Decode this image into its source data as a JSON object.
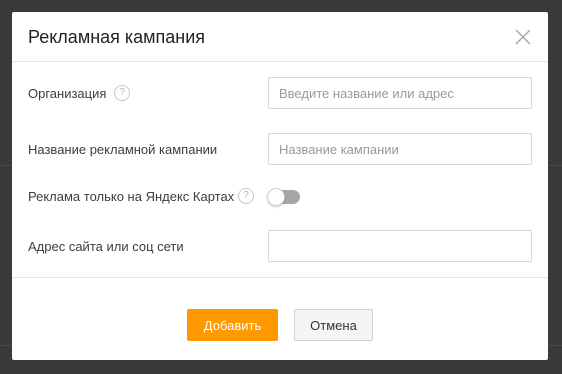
{
  "dialog": {
    "title": "Рекламная кампания",
    "close_icon": "close-icon"
  },
  "form": {
    "organization": {
      "label": "Организация",
      "help_icon": "question-icon",
      "help_glyph": "?",
      "placeholder": "Введите название или адрес",
      "value": ""
    },
    "campaign_name": {
      "label": "Название рекламной кампании",
      "placeholder": "Название кампании",
      "value": ""
    },
    "maps_only": {
      "label": "Реклама только на Яндекс Картах",
      "help_icon": "question-icon",
      "help_glyph": "?",
      "enabled": false
    },
    "site_address": {
      "label": "Адрес сайта или соц сети",
      "placeholder": "",
      "value": ""
    }
  },
  "buttons": {
    "add_label": "Добавить",
    "cancel_label": "Отмена"
  },
  "colors": {
    "accent": "#ff9900",
    "toggle_off": "#a6a6a6",
    "backdrop": "#3a3a3a"
  }
}
